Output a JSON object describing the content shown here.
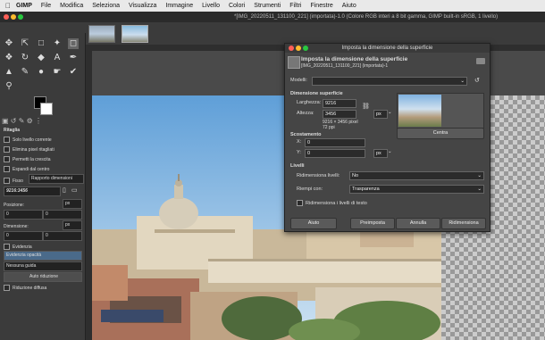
{
  "menubar": {
    "app": "GIMP",
    "items": [
      "File",
      "Modifica",
      "Seleziona",
      "Visualizza",
      "Immagine",
      "Livello",
      "Colori",
      "Strumenti",
      "Filtri",
      "Finestre",
      "Aiuto"
    ]
  },
  "window_title": "*[IMG_20220511_131100_221] (importata)-1.0 (Colore RGB interi a 8 bit gamma, GIMP built-in sRGB, 1 livello)",
  "toolbox": {
    "options_title": "Ritaglia",
    "options": [
      "Solo livello corrente",
      "Elimina pixel ritagliati",
      "Permetti la crescita",
      "Espandi dal centro"
    ],
    "fixed_label": "Fisso",
    "fixed_value": "Rapporto dimensioni",
    "ratio_value": "9216:3456",
    "position_label": "Posizione:",
    "position_unit": "px",
    "position_x": "0",
    "position_y": "0",
    "size_label": "Dimensione:",
    "size_unit": "px",
    "size_w": "0",
    "size_h": "0",
    "highlight_label": "Evidenzia",
    "highlight_opacity": "Evidenzia opacità",
    "highlight_value": "50.0",
    "guides_value": "Nessuna guida",
    "auto_shrink": "Auto riduzione",
    "shrink_merged": "Riduzione diffusa"
  },
  "dialog": {
    "title": "Imposta la dimensione della superficie",
    "header_title": "Imposta la dimensione della superficie",
    "header_sub": "[IMG_20220511_131100_221] (importata)-1",
    "presets_label": "Modelli:",
    "canvas_size_title": "Dimensione superficie",
    "width_label": "Larghezza:",
    "width_value": "9216",
    "height_label": "Altezza:",
    "height_value": "3456",
    "size_info": "9216 × 3456 pixel",
    "ppi_info": "72 ppi",
    "unit": "px",
    "offset_title": "Scostamento",
    "x_label": "X:",
    "x_value": "0",
    "y_label": "Y:",
    "y_value": "0",
    "offset_unit": "px",
    "center_button": "Centra",
    "layers_title": "Livelli",
    "resize_layers_label": "Ridimensiona livelli:",
    "resize_layers_value": "No",
    "fill_label": "Riempi con:",
    "fill_value": "Trasparenza",
    "text_layers_label": "Ridimensiona i livelli di testo",
    "buttons": {
      "help": "Aiuto",
      "reset": "Preimposta",
      "cancel": "Annulla",
      "resize": "Ridimensiona"
    }
  }
}
